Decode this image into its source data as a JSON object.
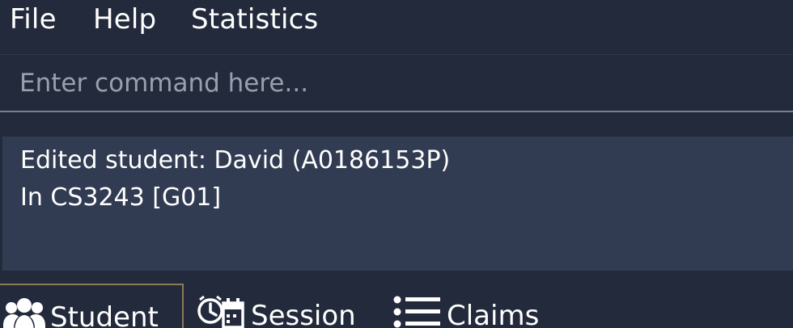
{
  "menu": {
    "file": "File",
    "help": "Help",
    "statistics": "Statistics"
  },
  "command": {
    "placeholder": "Enter command here...",
    "value": ""
  },
  "result": {
    "line1": "Edited student: David (A0186153P)",
    "line2": "In CS3243 [G01]"
  },
  "tabs": [
    {
      "label": "Student",
      "icon": "students-icon",
      "selected": true
    },
    {
      "label": "Session",
      "icon": "session-clock-calendar-icon",
      "selected": false
    },
    {
      "label": "Claims",
      "icon": "list-icon",
      "selected": false
    }
  ],
  "colors": {
    "background": "#232a3b",
    "result_panel": "#313b52",
    "selected_tab_border": "#8b7b56",
    "text": "#ffffff",
    "placeholder": "#9aa0ab"
  }
}
